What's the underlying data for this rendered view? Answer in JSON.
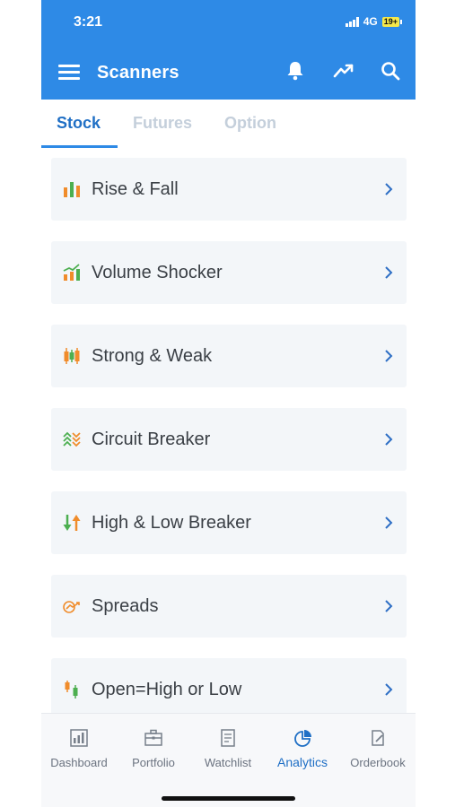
{
  "status": {
    "time": "3:21",
    "network": "4G",
    "battery": "19+"
  },
  "header": {
    "title": "Scanners"
  },
  "tabs": [
    {
      "label": "Stock",
      "active": true
    },
    {
      "label": "Futures",
      "active": false
    },
    {
      "label": "Option",
      "active": false
    }
  ],
  "scanners": [
    {
      "label": "Rise & Fall",
      "icon": "bar-chart-icon"
    },
    {
      "label": "Volume Shocker",
      "icon": "volume-chart-icon"
    },
    {
      "label": "Strong & Weak",
      "icon": "candlestick-icon"
    },
    {
      "label": "Circuit Breaker",
      "icon": "chevrons-icon"
    },
    {
      "label": "High & Low Breaker",
      "icon": "up-down-arrows-icon"
    },
    {
      "label": "Spreads",
      "icon": "spread-icon"
    },
    {
      "label": "Open=High or Low",
      "icon": "open-high-low-icon"
    }
  ],
  "nav": [
    {
      "label": "Dashboard",
      "icon": "dashboard-icon",
      "active": false
    },
    {
      "label": "Portfolio",
      "icon": "briefcase-icon",
      "active": false
    },
    {
      "label": "Watchlist",
      "icon": "watchlist-icon",
      "active": false
    },
    {
      "label": "Analytics",
      "icon": "pie-chart-icon",
      "active": true
    },
    {
      "label": "Orderbook",
      "icon": "orderbook-icon",
      "active": false
    }
  ],
  "colors": {
    "brand": "#2e8ae6",
    "active_text": "#1f6fc5",
    "green": "#4caf50",
    "orange": "#f08c2b"
  }
}
